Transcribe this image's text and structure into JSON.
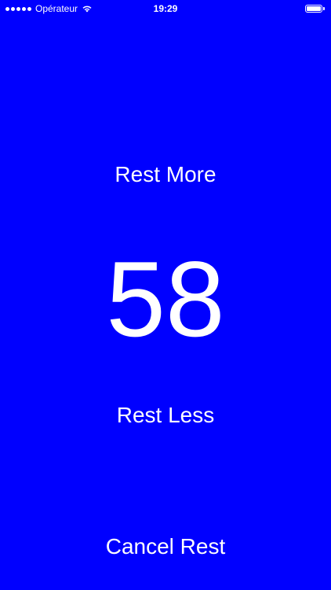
{
  "status_bar": {
    "carrier": "Opérateur",
    "time": "19:29",
    "battery_level": 1.0,
    "signal_bars": 5
  },
  "colors": {
    "background": "#0000FF",
    "text": "#FFFFFF"
  },
  "rest_timer": {
    "rest_more_label": "Rest More",
    "seconds_remaining": "58",
    "rest_less_label": "Rest Less",
    "cancel_label": "Cancel Rest"
  },
  "icons": {
    "wifi": "wifi-icon",
    "battery": "battery-icon",
    "signal": "signal-icon"
  }
}
